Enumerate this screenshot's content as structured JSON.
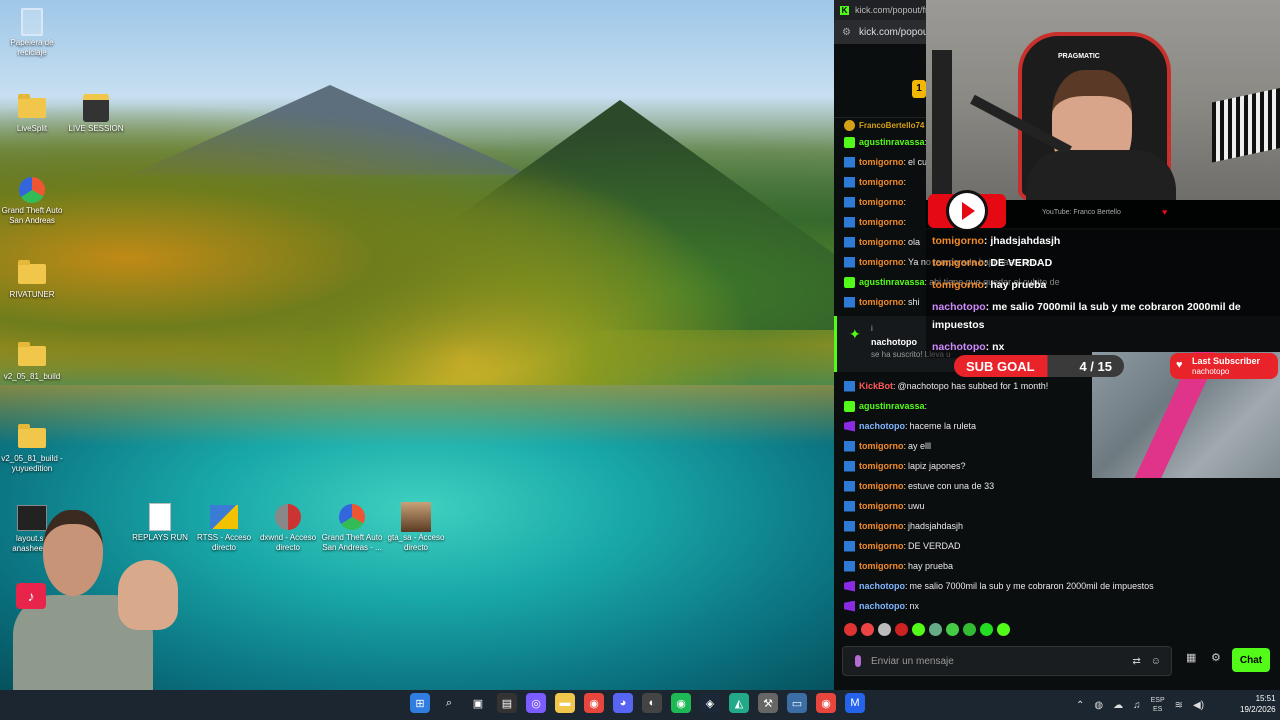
{
  "desktop": {
    "icons_left": [
      {
        "label": "Papelera de reciclaje",
        "icon": "recycle-bin-icon"
      },
      {
        "label": "LiveSplit",
        "icon": "folder-icon"
      },
      {
        "label": "LIVE SESSION",
        "icon": "app-icon"
      },
      {
        "label": "Grand Theft Auto San Andreas",
        "icon": "gta-icon"
      },
      {
        "label": "RIVATUNER",
        "icon": "folder-icon"
      },
      {
        "label": "v2_05_81_build",
        "icon": "folder-icon"
      },
      {
        "label": "v2_05_81_build - yuyuedition",
        "icon": "folder-icon"
      },
      {
        "label": "layout.sp anasheeee",
        "icon": "terminal-icon"
      }
    ],
    "icons_row": [
      {
        "label": "REPLAYS RUN",
        "icon": "document-icon"
      },
      {
        "label": "RTSS - Acceso directo",
        "icon": "app-icon"
      },
      {
        "label": "dxwnd - Acceso directo",
        "icon": "app-icon"
      },
      {
        "label": "Grand Theft Auto San Andreas - ...",
        "icon": "gta-icon"
      },
      {
        "label": "gta_sa - Acceso directo",
        "icon": "photo-icon"
      }
    ]
  },
  "browser": {
    "tab_title": "kick.com/popout/fra",
    "url": "kick.com/popou",
    "pinned_user": "FrancoBertello74",
    "messages_top": [
      {
        "user": "agustinravassa",
        "text": "",
        "badge": "green",
        "color": "green"
      },
      {
        "user": "tomigorno",
        "text": "el cu",
        "badge": "blue",
        "color": "orange"
      },
      {
        "user": "tomigorno",
        "text": "",
        "badge": "blue",
        "color": "orange"
      },
      {
        "user": "tomigorno",
        "text": "",
        "badge": "blue",
        "color": "orange"
      },
      {
        "user": "tomigorno",
        "text": "",
        "badge": "blue",
        "color": "orange"
      },
      {
        "user": "tomigorno",
        "text": "ola",
        "badge": "blue",
        "color": "orange"
      },
      {
        "user": "tomigorno",
        "text": "Ya no temporada baja hasta octu",
        "badge": "blue",
        "color": "orange"
      },
      {
        "user": "agustinravassa",
        "text": "ahi tiene que quedar el cubito de",
        "badge": "green",
        "color": "green"
      },
      {
        "user": "tomigorno",
        "text": "shi",
        "badge": "blue",
        "color": "orange"
      }
    ],
    "sub_notice": {
      "info": "i",
      "user": "nachotopo",
      "text": "se ha suscrito! Lleva u"
    },
    "messages_bottom": [
      {
        "user": "KickBot",
        "text": "@nachotopo has subbed for 1 month!",
        "badge": "blue",
        "color": "red"
      },
      {
        "user": "agustinravassa",
        "text": "",
        "badge": "green",
        "color": "green"
      },
      {
        "user": "nachotopo",
        "text": "haceme la ruleta",
        "badge": "purple",
        "color": "blue"
      },
      {
        "user": "tomigorno",
        "text": "ay elll",
        "badge": "blue",
        "color": "orange"
      },
      {
        "user": "tomigorno",
        "text": "lapiz japones?",
        "badge": "blue",
        "color": "orange"
      },
      {
        "user": "tomigorno",
        "text": "estuve con una de 33",
        "badge": "blue",
        "color": "orange"
      },
      {
        "user": "tomigorno",
        "text": "uwu",
        "badge": "blue",
        "color": "orange"
      },
      {
        "user": "tomigorno",
        "text": "jhadsjahdasjh",
        "badge": "blue",
        "color": "orange"
      },
      {
        "user": "tomigorno",
        "text": "DE VERDAD",
        "badge": "blue",
        "color": "orange"
      },
      {
        "user": "tomigorno",
        "text": "hay prueba",
        "badge": "blue",
        "color": "orange"
      },
      {
        "user": "nachotopo",
        "text": "me salio 7000mil la sub y me cobraron 2000mil de impuestos",
        "badge": "purple",
        "color": "blue"
      },
      {
        "user": "nachotopo",
        "text": "nx",
        "badge": "purple",
        "color": "blue"
      }
    ],
    "coin_label": "1",
    "input_placeholder": "Enviar un mensaje",
    "chat_button": "Chat"
  },
  "overlay": {
    "chair_brand": "PRAGMATIC",
    "yt_text": "YouTube: Franco Bertello",
    "chat": [
      {
        "user": "tomigorno",
        "text": ": jhadsjahdasjh",
        "color": "orange"
      },
      {
        "user": "tomigorno",
        "text": ": DE VERDAD",
        "color": "orange"
      },
      {
        "user": "tomigorno",
        "text": ": hay prueba",
        "color": "orange"
      },
      {
        "user": "nachotopo",
        "text": ": me salio 7000mil la sub y me cobraron 2000mil de impuestos",
        "color": "purple"
      },
      {
        "user": "nachotopo",
        "text": ": nx",
        "color": "purple"
      }
    ],
    "sub_goal": {
      "label": "SUB GOAL",
      "count": "4 / 15",
      "progress": 0.27
    },
    "last_subscriber": {
      "title": "Last Subscriber",
      "name": "nachotopo"
    }
  },
  "taskbar": {
    "apps": [
      "windows-start-icon",
      "search-icon",
      "task-view-icon",
      "store-icon",
      "circle-app-icon",
      "file-explorer-icon",
      "chrome-icon",
      "discord-icon",
      "obs-icon",
      "spotify-icon",
      "steam-icon",
      "gta-icon",
      "tool-icon",
      "monitor-icon",
      "chrome-icon",
      "mail-icon"
    ],
    "lang_top": "ESP",
    "lang_bottom": "ES",
    "time": "15:51",
    "date": "19/2/2026"
  },
  "colors": {
    "kick_green": "#53fc18",
    "overlay_red": "#e8232a",
    "taskbar": "#1c2630"
  }
}
